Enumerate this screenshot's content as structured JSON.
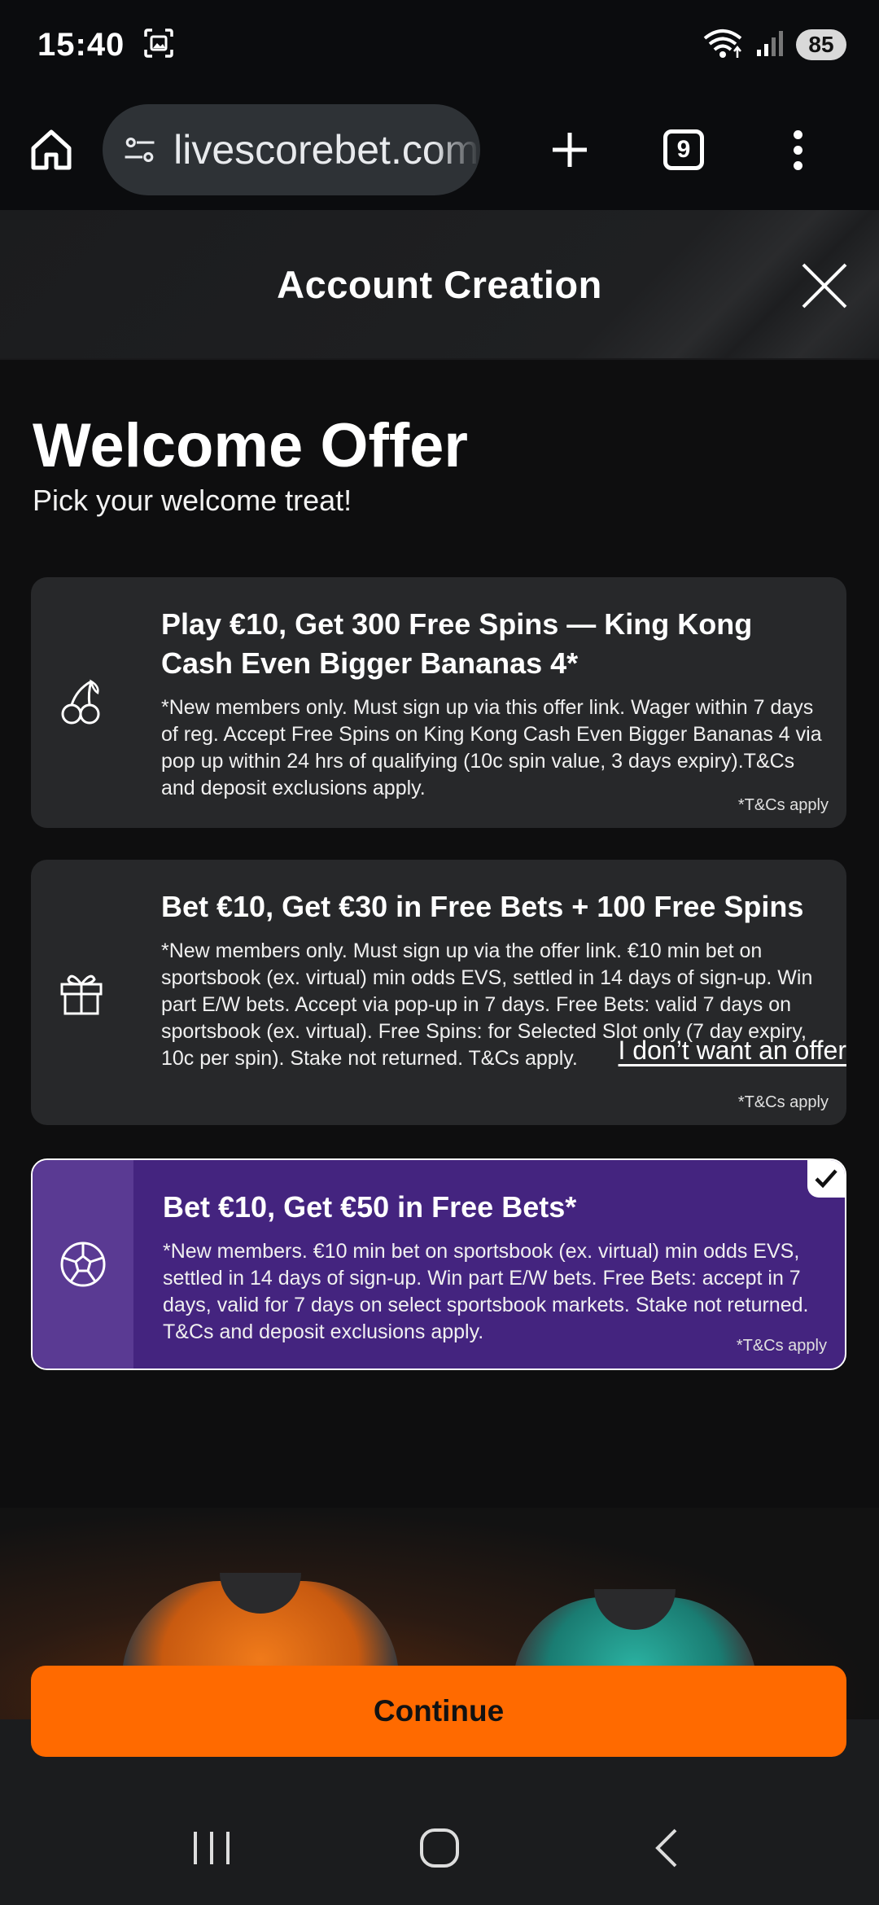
{
  "status_bar": {
    "time": "15:40",
    "battery": "85"
  },
  "browser": {
    "url": "livescorebet.com/ie",
    "tab_count": "9"
  },
  "header": {
    "title": "Account Creation"
  },
  "welcome": {
    "title": "Welcome Offer",
    "subtitle": "Pick your welcome treat!"
  },
  "offers": [
    {
      "title": "Play €10, Get 300 Free Spins — King Kong Cash Even Bigger Bananas 4*",
      "description": "*New members only. Must sign up via this offer link. Wager within 7 days of reg. Accept Free Spins on King Kong Cash Even Bigger Bananas 4 via pop up within 24 hrs of qualifying (10c spin value, 3 days expiry).T&Cs and deposit exclusions apply.",
      "tcs": "*T&Cs apply",
      "icon": "cherry-icon",
      "selected": false
    },
    {
      "title": "Bet €10, Get €30 in Free Bets + 100 Free Spins",
      "description": "*New members only. Must sign up via the offer link. €10 min bet on sportsbook (ex. virtual) min odds EVS, settled in 14 days of sign-up. Win part E/W bets. Accept via pop-up in 7 days. Free Bets: valid 7 days on sportsbook (ex. virtual). Free Spins: for Selected Slot only (7 day expiry, 10c per spin). Stake not returned. T&Cs apply.",
      "tcs": "*T&Cs apply",
      "icon": "gift-icon",
      "selected": false
    },
    {
      "title": "Bet €10, Get €50 in Free Bets*",
      "description": "*New members. €10 min bet on sportsbook (ex. virtual) min odds EVS, settled in 14 days of sign-up. Win part E/W bets. Free Bets: accept in 7 days, valid for 7 days on select sportsbook markets. Stake not returned. T&Cs and deposit exclusions apply.",
      "tcs": "*T&Cs apply",
      "icon": "football-icon",
      "selected": true
    }
  ],
  "no_offer_label": "I don’t want an offer",
  "continue_label": "Continue",
  "colors": {
    "accent": "#ff6a00",
    "selected_card": "#44247f"
  }
}
